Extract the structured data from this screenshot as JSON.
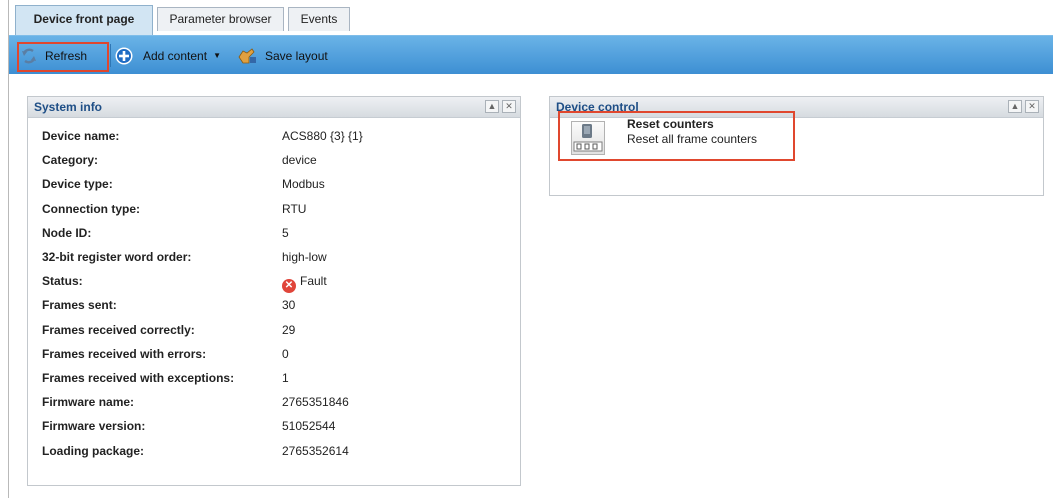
{
  "tabs": [
    {
      "label": "Device front page",
      "active": true
    },
    {
      "label": "Parameter browser",
      "active": false
    },
    {
      "label": "Events",
      "active": false
    }
  ],
  "toolbar": {
    "refresh_label": "Refresh",
    "refresh_icon": "refresh-icon",
    "add_content_label": "Add content",
    "add_icon": "plus-circle-icon",
    "save_layout_label": "Save layout",
    "save_icon": "hand-save-icon",
    "highlight_color": "#e0472e"
  },
  "system_info": {
    "title": "System info",
    "rows": [
      {
        "label": "Device name:",
        "value": "ACS880 {3} {1}"
      },
      {
        "label": "Category:",
        "value": "device"
      },
      {
        "label": "Device type:",
        "value": "Modbus"
      },
      {
        "label": "Connection type:",
        "value": "RTU"
      },
      {
        "label": "Node ID:",
        "value": "5"
      },
      {
        "label": "32-bit register word order:",
        "value": "high-low"
      },
      {
        "label": "Status:",
        "value": "Fault"
      },
      {
        "label": "Frames sent:",
        "value": "30"
      },
      {
        "label": "Frames received correctly:",
        "value": "29"
      },
      {
        "label": "Frames received with errors:",
        "value": "0"
      },
      {
        "label": "Frames received with exceptions:",
        "value": "1"
      },
      {
        "label": "Firmware name:",
        "value": "2765351846"
      },
      {
        "label": "Firmware version:",
        "value": "51052544"
      },
      {
        "label": "Loading package:",
        "value": "2765352614"
      }
    ]
  },
  "device_control": {
    "title": "Device control",
    "reset": {
      "title": "Reset counters",
      "description": "Reset all frame counters"
    }
  },
  "colors": {
    "toolbar_top": "#6ab3e7",
    "toolbar_bottom": "#3d8fd3",
    "panel_title": "#1e4e86",
    "fault": "#e0453a"
  }
}
